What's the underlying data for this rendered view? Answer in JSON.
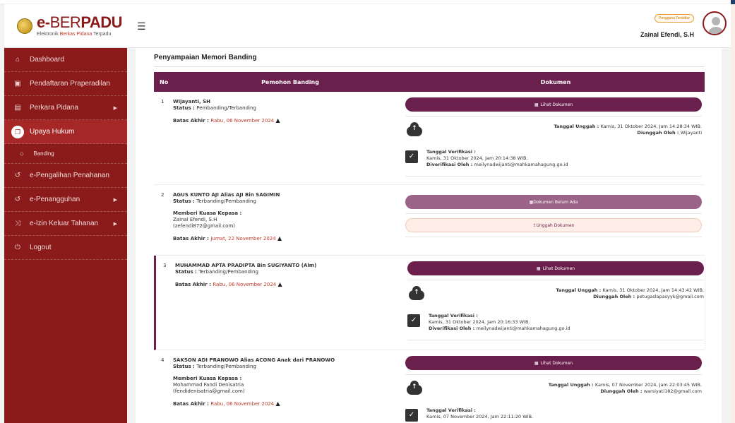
{
  "logo": {
    "brand_a": "e-",
    "brand_b": "BER",
    "brand_c": "PADU",
    "sub_a": "Elektronik ",
    "sub_b": "Berkas Pidana",
    "sub_c": " Terpadu"
  },
  "menu_icon": "hamburger-icon",
  "user": {
    "badge": "Pengguna Terdaftar",
    "name": "Zainal Efendi, S.H"
  },
  "sidebar": {
    "items": [
      {
        "label": "Dashboard",
        "icon": "home-icon"
      },
      {
        "label": "Pendaftaran Praperadilan",
        "icon": "book-icon"
      },
      {
        "label": "Perkara Pidana",
        "icon": "folder-icon"
      },
      {
        "label": "Upaya Hukum",
        "icon": "copy-icon"
      },
      {
        "label": "Banding",
        "icon": "circle-icon"
      },
      {
        "label": "e-Pengalihan Penahanan",
        "icon": "history-icon"
      },
      {
        "label": "e-Penangguhan",
        "icon": "history-icon"
      },
      {
        "label": "e-Izin Keluar Tahanan",
        "icon": "shuffle-icon"
      },
      {
        "label": "Logout",
        "icon": "power-icon"
      }
    ]
  },
  "page": {
    "title": "Penyampaian Memori Banding"
  },
  "table": {
    "headers": {
      "no": "No",
      "pemohon": "Pemohon Banding",
      "dokumen": "Dokumen"
    },
    "labels": {
      "status": "Status : ",
      "batas": "Batas Akhir : ",
      "kuasa": "Memberi Kuasa Kepasa :",
      "lihat": "Lihat Dokumen",
      "belum": "Dokumen Belum Ada",
      "unggah": "Unggah Dokumen",
      "tgl_unggah": "Tanggal Unggah : ",
      "diunggah": "Diunggah Oleh : ",
      "tgl_verif": "Tanggal Verifikasi :",
      "diverif": "Diverifikasi Oleh : "
    },
    "rows": [
      {
        "no": "1",
        "name": "Wijayanti, SH",
        "status": "Pembanding/Terbanding",
        "deadline": "Rabu, 06 November 2024",
        "upload_date": "Kamis, 31 Oktober 2024, Jam 14:28:34 WIB.",
        "uploader": "Wijayanti",
        "verify_date": "Kamis, 31 Oktober 2024, Jam 20:14:38 WIB.",
        "verifier": "meilynadwijanti@mahkamahagung.go.id"
      },
      {
        "no": "2",
        "name": "AGUS KUNTO AJI Alias AJI Bin SAGIMIN",
        "status": "Terbanding/Pembanding",
        "kuasa_name": "Zainal Efendi, S.H",
        "kuasa_email": "(zefendi872@gmail.com)",
        "deadline": "Jumat, 22 November 2024"
      },
      {
        "no": "3",
        "name": "MUHAMMAD APTA PRADIPTA Bin SUGIYANTO (Alm)",
        "status": "Terbanding/Pembanding",
        "deadline": "Rabu, 06 November 2024",
        "upload_date": "Kamis, 31 Oktober 2024, Jam 14:43:42 WIB.",
        "uploader": "petugaslapasyyk@gmail.com",
        "verify_date": "Kamis, 31 Oktober 2024, Jam 20:16:33 WIB.",
        "verifier": "meilynadwijanti@mahkamahagung.go.id"
      },
      {
        "no": "4",
        "name": "SAKSON ADI PRANOWO Alias ACONG Anak dari PRANOWO",
        "status": "Terbanding/Pembanding",
        "kuasa_name": "Mohammad Fandi Denisatria",
        "kuasa_email": "(fendidenisatria@gmail.com)",
        "deadline": "Rabu, 06 November 2024",
        "upload_date": "Kamis, 07 November 2024, Jam 22:03:45 WIB.",
        "uploader": "warsiyati182@gmail.com",
        "verify_date": "Kamis, 07 November 2024, Jam 22:11:20 WIB."
      }
    ]
  }
}
